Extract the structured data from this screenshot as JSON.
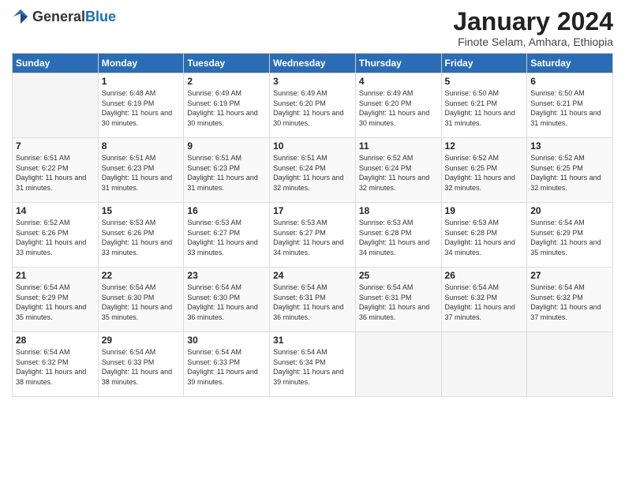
{
  "header": {
    "logo_general": "General",
    "logo_blue": "Blue",
    "month_title": "January 2024",
    "subtitle": "Finote Selam, Amhara, Ethiopia"
  },
  "weekdays": [
    "Sunday",
    "Monday",
    "Tuesday",
    "Wednesday",
    "Thursday",
    "Friday",
    "Saturday"
  ],
  "weeks": [
    [
      {
        "day": "",
        "sunrise": "",
        "sunset": "",
        "daylight": ""
      },
      {
        "day": "1",
        "sunrise": "Sunrise: 6:48 AM",
        "sunset": "Sunset: 6:19 PM",
        "daylight": "Daylight: 11 hours and 30 minutes."
      },
      {
        "day": "2",
        "sunrise": "Sunrise: 6:49 AM",
        "sunset": "Sunset: 6:19 PM",
        "daylight": "Daylight: 11 hours and 30 minutes."
      },
      {
        "day": "3",
        "sunrise": "Sunrise: 6:49 AM",
        "sunset": "Sunset: 6:20 PM",
        "daylight": "Daylight: 11 hours and 30 minutes."
      },
      {
        "day": "4",
        "sunrise": "Sunrise: 6:49 AM",
        "sunset": "Sunset: 6:20 PM",
        "daylight": "Daylight: 11 hours and 30 minutes."
      },
      {
        "day": "5",
        "sunrise": "Sunrise: 6:50 AM",
        "sunset": "Sunset: 6:21 PM",
        "daylight": "Daylight: 11 hours and 31 minutes."
      },
      {
        "day": "6",
        "sunrise": "Sunrise: 6:50 AM",
        "sunset": "Sunset: 6:21 PM",
        "daylight": "Daylight: 11 hours and 31 minutes."
      }
    ],
    [
      {
        "day": "7",
        "sunrise": "Sunrise: 6:51 AM",
        "sunset": "Sunset: 6:22 PM",
        "daylight": "Daylight: 11 hours and 31 minutes."
      },
      {
        "day": "8",
        "sunrise": "Sunrise: 6:51 AM",
        "sunset": "Sunset: 6:23 PM",
        "daylight": "Daylight: 11 hours and 31 minutes."
      },
      {
        "day": "9",
        "sunrise": "Sunrise: 6:51 AM",
        "sunset": "Sunset: 6:23 PM",
        "daylight": "Daylight: 11 hours and 31 minutes."
      },
      {
        "day": "10",
        "sunrise": "Sunrise: 6:51 AM",
        "sunset": "Sunset: 6:24 PM",
        "daylight": "Daylight: 11 hours and 32 minutes."
      },
      {
        "day": "11",
        "sunrise": "Sunrise: 6:52 AM",
        "sunset": "Sunset: 6:24 PM",
        "daylight": "Daylight: 11 hours and 32 minutes."
      },
      {
        "day": "12",
        "sunrise": "Sunrise: 6:52 AM",
        "sunset": "Sunset: 6:25 PM",
        "daylight": "Daylight: 11 hours and 32 minutes."
      },
      {
        "day": "13",
        "sunrise": "Sunrise: 6:52 AM",
        "sunset": "Sunset: 6:25 PM",
        "daylight": "Daylight: 11 hours and 32 minutes."
      }
    ],
    [
      {
        "day": "14",
        "sunrise": "Sunrise: 6:52 AM",
        "sunset": "Sunset: 6:26 PM",
        "daylight": "Daylight: 11 hours and 33 minutes."
      },
      {
        "day": "15",
        "sunrise": "Sunrise: 6:53 AM",
        "sunset": "Sunset: 6:26 PM",
        "daylight": "Daylight: 11 hours and 33 minutes."
      },
      {
        "day": "16",
        "sunrise": "Sunrise: 6:53 AM",
        "sunset": "Sunset: 6:27 PM",
        "daylight": "Daylight: 11 hours and 33 minutes."
      },
      {
        "day": "17",
        "sunrise": "Sunrise: 6:53 AM",
        "sunset": "Sunset: 6:27 PM",
        "daylight": "Daylight: 11 hours and 34 minutes."
      },
      {
        "day": "18",
        "sunrise": "Sunrise: 6:53 AM",
        "sunset": "Sunset: 6:28 PM",
        "daylight": "Daylight: 11 hours and 34 minutes."
      },
      {
        "day": "19",
        "sunrise": "Sunrise: 6:53 AM",
        "sunset": "Sunset: 6:28 PM",
        "daylight": "Daylight: 11 hours and 34 minutes."
      },
      {
        "day": "20",
        "sunrise": "Sunrise: 6:54 AM",
        "sunset": "Sunset: 6:29 PM",
        "daylight": "Daylight: 11 hours and 35 minutes."
      }
    ],
    [
      {
        "day": "21",
        "sunrise": "Sunrise: 6:54 AM",
        "sunset": "Sunset: 6:29 PM",
        "daylight": "Daylight: 11 hours and 35 minutes."
      },
      {
        "day": "22",
        "sunrise": "Sunrise: 6:54 AM",
        "sunset": "Sunset: 6:30 PM",
        "daylight": "Daylight: 11 hours and 35 minutes."
      },
      {
        "day": "23",
        "sunrise": "Sunrise: 6:54 AM",
        "sunset": "Sunset: 6:30 PM",
        "daylight": "Daylight: 11 hours and 36 minutes."
      },
      {
        "day": "24",
        "sunrise": "Sunrise: 6:54 AM",
        "sunset": "Sunset: 6:31 PM",
        "daylight": "Daylight: 11 hours and 36 minutes."
      },
      {
        "day": "25",
        "sunrise": "Sunrise: 6:54 AM",
        "sunset": "Sunset: 6:31 PM",
        "daylight": "Daylight: 11 hours and 36 minutes."
      },
      {
        "day": "26",
        "sunrise": "Sunrise: 6:54 AM",
        "sunset": "Sunset: 6:32 PM",
        "daylight": "Daylight: 11 hours and 37 minutes."
      },
      {
        "day": "27",
        "sunrise": "Sunrise: 6:54 AM",
        "sunset": "Sunset: 6:32 PM",
        "daylight": "Daylight: 11 hours and 37 minutes."
      }
    ],
    [
      {
        "day": "28",
        "sunrise": "Sunrise: 6:54 AM",
        "sunset": "Sunset: 6:32 PM",
        "daylight": "Daylight: 11 hours and 38 minutes."
      },
      {
        "day": "29",
        "sunrise": "Sunrise: 6:54 AM",
        "sunset": "Sunset: 6:33 PM",
        "daylight": "Daylight: 11 hours and 38 minutes."
      },
      {
        "day": "30",
        "sunrise": "Sunrise: 6:54 AM",
        "sunset": "Sunset: 6:33 PM",
        "daylight": "Daylight: 11 hours and 39 minutes."
      },
      {
        "day": "31",
        "sunrise": "Sunrise: 6:54 AM",
        "sunset": "Sunset: 6:34 PM",
        "daylight": "Daylight: 11 hours and 39 minutes."
      },
      {
        "day": "",
        "sunrise": "",
        "sunset": "",
        "daylight": ""
      },
      {
        "day": "",
        "sunrise": "",
        "sunset": "",
        "daylight": ""
      },
      {
        "day": "",
        "sunrise": "",
        "sunset": "",
        "daylight": ""
      }
    ]
  ]
}
